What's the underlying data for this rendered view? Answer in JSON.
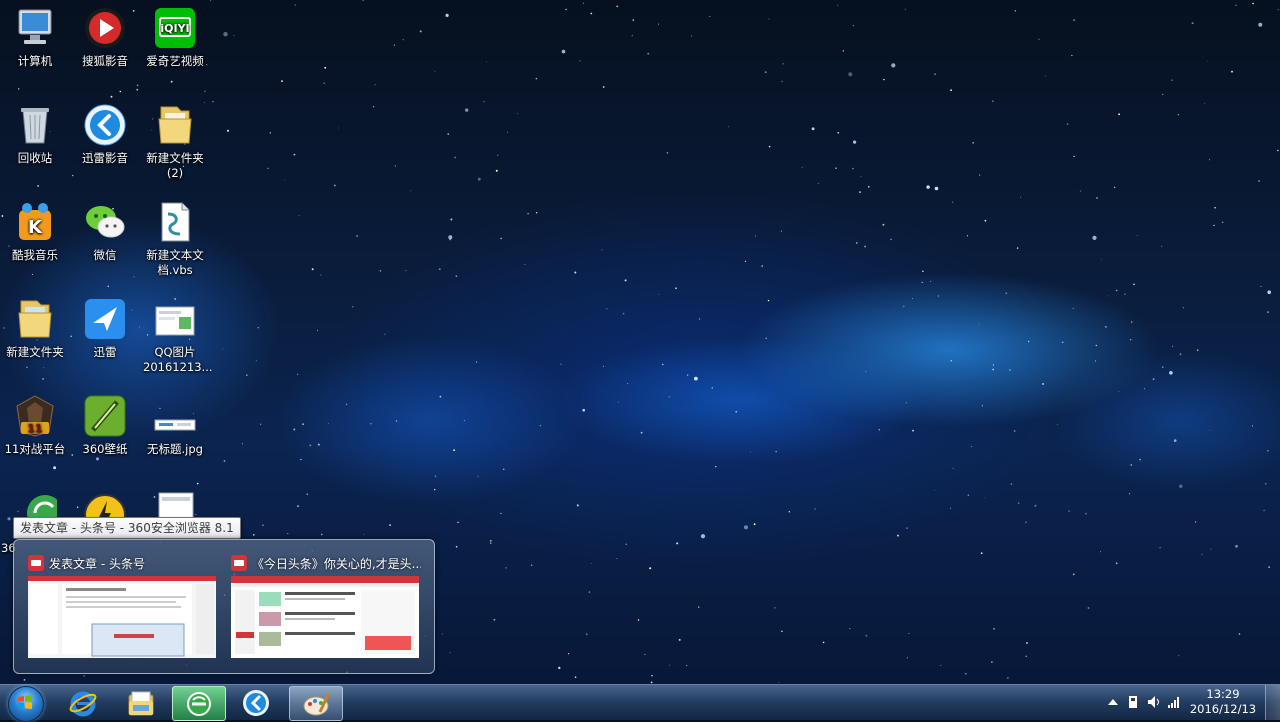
{
  "desktop": {
    "icons": [
      {
        "label": "计算机"
      },
      {
        "label": "搜狐影音"
      },
      {
        "label": "爱奇艺视频"
      },
      {
        "label": "回收站"
      },
      {
        "label": "迅雷影音"
      },
      {
        "label": "新建文件夹\n(2)"
      },
      {
        "label": "酷我音乐"
      },
      {
        "label": "微信"
      },
      {
        "label": "新建文本文\n档.vbs"
      },
      {
        "label": "新建文件夹"
      },
      {
        "label": "迅雷"
      },
      {
        "label": "QQ图片\n20161213..."
      },
      {
        "label": "11对战平台"
      },
      {
        "label": "360壁纸"
      },
      {
        "label": "无标题.jpg"
      },
      {
        "label": "36"
      }
    ]
  },
  "tooltip": {
    "text": "发表文章 - 头条号 - 360安全浏览器 8.1"
  },
  "thumbnails": [
    {
      "title": "发表文章 - 头条号"
    },
    {
      "title": "《今日头条》你关心的,才是头..."
    }
  ],
  "taskbar": {
    "apps": [
      "start-orb",
      "internet-explorer",
      "windows-explorer",
      "360-browser",
      "xunlei-player",
      "paint"
    ],
    "clock": {
      "time": "13:29",
      "date": "2016/12/13"
    }
  },
  "colors": {
    "accent": "#2a7fd0",
    "browser_green": "#3aa84a"
  }
}
